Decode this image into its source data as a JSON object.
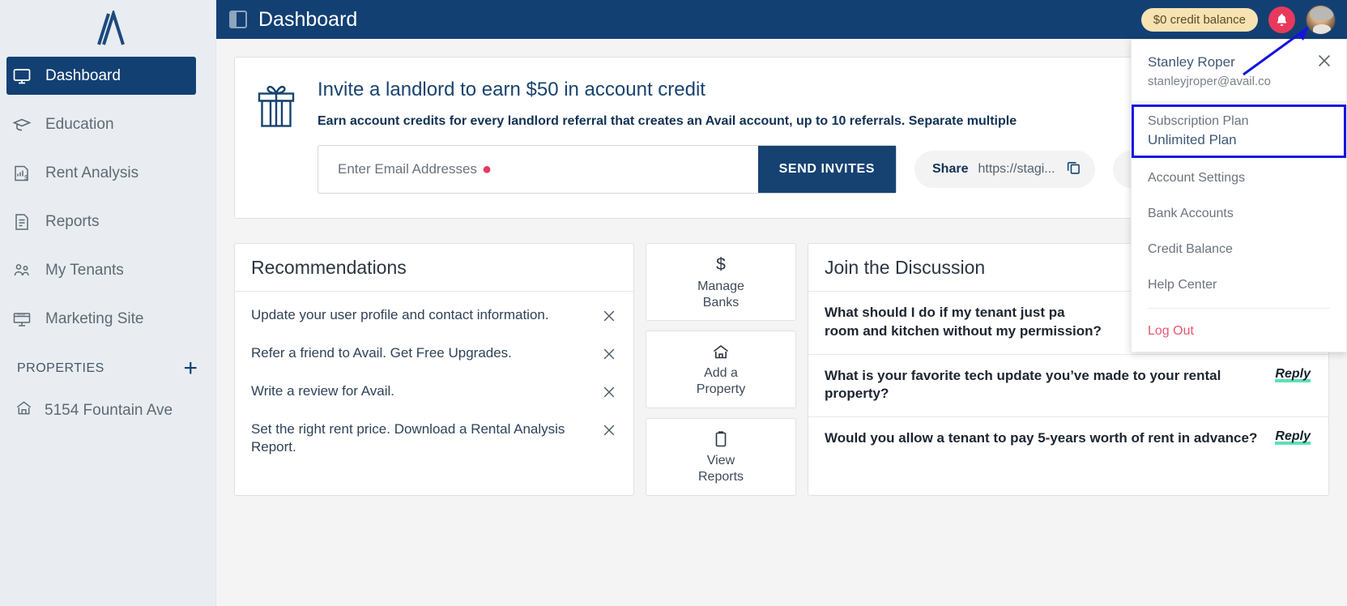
{
  "sidebar": {
    "logo_alt": "avail-logo",
    "items": [
      {
        "label": "Dashboard",
        "icon": "monitor-icon",
        "active": true
      },
      {
        "label": "Education",
        "icon": "graduation-cap-icon",
        "active": false
      },
      {
        "label": "Rent Analysis",
        "icon": "report-dollar-icon",
        "active": false
      },
      {
        "label": "Reports",
        "icon": "document-list-icon",
        "active": false
      },
      {
        "label": "My Tenants",
        "icon": "people-icon",
        "active": false
      },
      {
        "label": "Marketing Site",
        "icon": "web-monitor-icon",
        "active": false
      }
    ],
    "properties_header": "PROPERTIES",
    "add_property_glyph": "+",
    "properties": [
      {
        "label": "5154 Fountain Ave",
        "icon": "house-icon"
      }
    ]
  },
  "topbar": {
    "panel_toggle_icon": "panel-toggle-icon",
    "title": "Dashboard",
    "credit_badge": "$0 credit balance",
    "bell_icon": "bell-icon",
    "avatar_alt": "user-avatar",
    "bg_color": "#134073",
    "badge_color": "#f7e3b2",
    "bell_color": "#e8395c"
  },
  "user_menu": {
    "name": "Stanley Roper",
    "email": "stanleyjroper@avail.co",
    "close_icon": "close-icon",
    "plan_label": "Subscription Plan",
    "plan_value": "Unlimited Plan",
    "highlight_color": "#1414e0",
    "items": [
      {
        "label": "Account Settings"
      },
      {
        "label": "Bank Accounts"
      },
      {
        "label": "Credit Balance"
      },
      {
        "label": "Help Center"
      }
    ],
    "logout": "Log Out",
    "logout_color": "#e8566f"
  },
  "referral": {
    "gift_icon": "gift-icon",
    "title": "Invite a landlord to earn $50 in account credit",
    "subtitle": "Earn account credits for every landlord referral that creates an Avail account, up to 10 referrals. Separate multiple",
    "email_placeholder": "Enter Email Addresses",
    "required_marker": "●",
    "send_button": "SEND INVITES",
    "share_label": "Share",
    "share_url": "https://stagi...",
    "copy_icon": "copy-icon"
  },
  "recommendations": {
    "title": "Recommendations",
    "dismiss_icon": "close-icon",
    "items": [
      {
        "text": "Update your user profile and contact information."
      },
      {
        "text": "Refer a friend to Avail. Get Free Upgrades."
      },
      {
        "text": "Write a review for Avail."
      },
      {
        "text": "Set the right rent price. Download a Rental Analysis Report."
      }
    ]
  },
  "quick_actions": [
    {
      "label": "Manage\nBanks",
      "icon": "dollar-icon"
    },
    {
      "label": "Add a\nProperty",
      "icon": "home-icon"
    },
    {
      "label": "View\nReports",
      "icon": "clipboard-icon"
    }
  ],
  "discussion": {
    "title": "Join the Discussion",
    "reply_label": "Reply",
    "reply_underline_color": "#5ce0b6",
    "threads": [
      {
        "question": "What should I do if my tenant just pa\nroom and kitchen without my permission?",
        "reply_visible": false
      },
      {
        "question": "What is your favorite tech update you’ve made to your rental property?",
        "reply_visible": true
      },
      {
        "question": "Would you allow a tenant to pay 5-years worth of rent in advance?",
        "reply_visible": true
      }
    ]
  }
}
